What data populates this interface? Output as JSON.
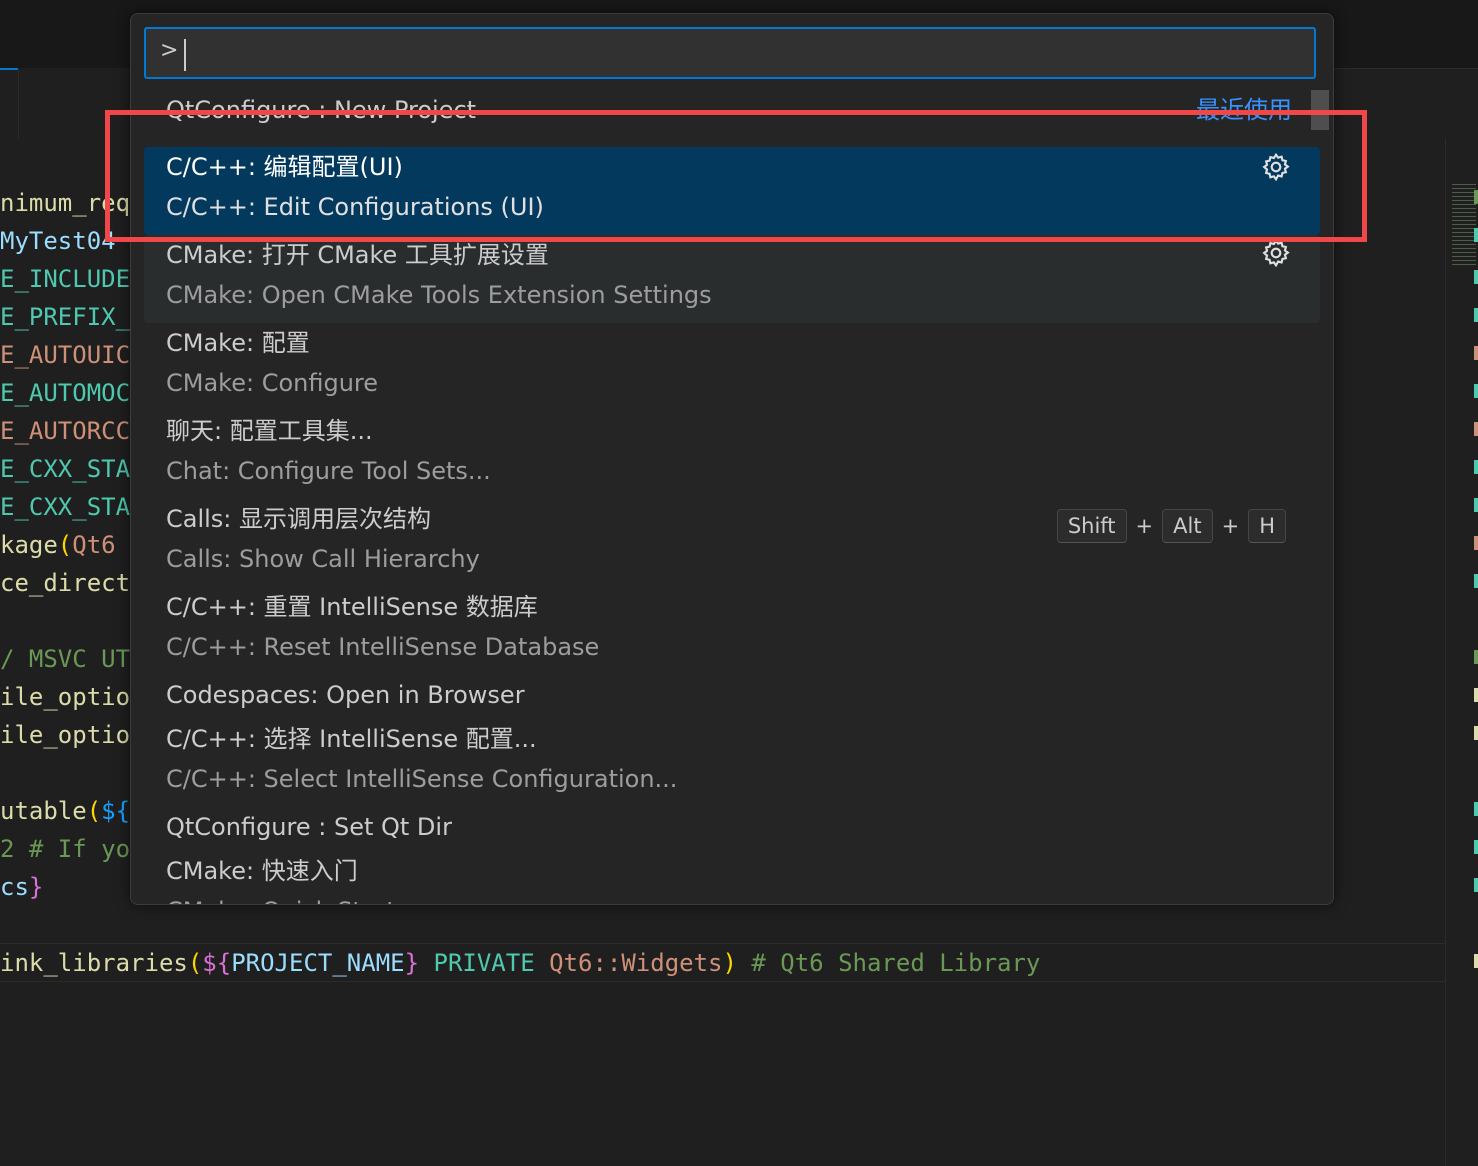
{
  "editor": {
    "lines": [
      {
        "parts": [
          {
            "t": "nimum_req",
            "c": "c-fn"
          }
        ]
      },
      {
        "parts": [
          {
            "t": "MyTest04",
            "c": "c-var"
          }
        ]
      },
      {
        "parts": [
          {
            "t": "E_INCLUDE",
            "c": "c-kw"
          }
        ]
      },
      {
        "parts": [
          {
            "t": "E_PREFIX_",
            "c": "c-kw"
          }
        ]
      },
      {
        "parts": [
          {
            "t": "E_AUTOUIC",
            "c": "c-str"
          }
        ]
      },
      {
        "parts": [
          {
            "t": "E_AUTOMOC",
            "c": "c-kw"
          }
        ]
      },
      {
        "parts": [
          {
            "t": "E_AUTORCC",
            "c": "c-str"
          }
        ]
      },
      {
        "parts": [
          {
            "t": "E_CXX_STA",
            "c": "c-kw"
          }
        ]
      },
      {
        "parts": [
          {
            "t": "E_CXX_STA",
            "c": "c-kw"
          }
        ]
      },
      {
        "parts": [
          {
            "t": "kage",
            "c": "c-fn"
          },
          {
            "t": "(",
            "c": "c-br"
          },
          {
            "t": "Qt6",
            "c": "c-str"
          }
        ]
      },
      {
        "parts": [
          {
            "t": "ce_direct",
            "c": "c-fn"
          }
        ]
      },
      {
        "parts": []
      },
      {
        "parts": [
          {
            "t": "/ MSVC UT",
            "c": "c-cm"
          }
        ]
      },
      {
        "parts": [
          {
            "t": "ile_optio",
            "c": "c-fn"
          }
        ]
      },
      {
        "parts": [
          {
            "t": "ile_optio",
            "c": "c-fn"
          }
        ]
      },
      {
        "parts": []
      },
      {
        "parts": [
          {
            "t": "utable",
            "c": "c-fn"
          },
          {
            "t": "(",
            "c": "c-br"
          },
          {
            "t": "${",
            "c": "c-br3"
          }
        ]
      },
      {
        "parts": [
          {
            "t": "2 # If yo",
            "c": "c-cm"
          }
        ]
      },
      {
        "parts": [
          {
            "t": "cs",
            "c": "c-var"
          },
          {
            "t": "}",
            "c": "c-br2"
          }
        ]
      },
      {
        "parts": []
      },
      {
        "parts": [
          {
            "t": "ink_libraries",
            "c": "c-fn"
          },
          {
            "t": "(",
            "c": "c-br"
          },
          {
            "t": "${",
            "c": "c-br2"
          },
          {
            "t": "PROJECT_NAME",
            "c": "c-var"
          },
          {
            "t": "}",
            "c": "c-br2"
          },
          {
            "t": " PRIVATE ",
            "c": "c-kw"
          },
          {
            "t": "Qt6::Widgets",
            "c": "c-str"
          },
          {
            "t": ")",
            "c": "c-br"
          },
          {
            "t": " # Qt6 Shared Library",
            "c": "c-cm"
          }
        ]
      }
    ]
  },
  "quick_pick": {
    "input_prefix": ">",
    "input_value": "",
    "recent_label": "最近使用",
    "items": [
      {
        "label": "QtConfigure : New Project",
        "detail": "",
        "state": "partial",
        "recent": true
      },
      {
        "label": "C/C++: 编辑配置(UI)",
        "detail": "C/C++: Edit Configurations (UI)",
        "state": "selected",
        "gear": true
      },
      {
        "label": "CMake: 打开 CMake 工具扩展设置",
        "detail": "CMake: Open CMake Tools Extension Settings",
        "state": "hover",
        "gear": true
      },
      {
        "label": "CMake: 配置",
        "detail": "CMake: Configure",
        "state": "normal"
      },
      {
        "label": "聊天: 配置工具集...",
        "detail": "Chat: Configure Tool Sets...",
        "state": "normal"
      },
      {
        "label": "Calls: 显示调用层次结构",
        "detail": "Calls: Show Call Hierarchy",
        "state": "normal",
        "keybinding": [
          "Shift",
          "Alt",
          "H"
        ]
      },
      {
        "label": "C/C++: 重置 IntelliSense 数据库",
        "detail": "C/C++: Reset IntelliSense Database",
        "state": "normal"
      },
      {
        "label": "Codespaces: Open in Browser",
        "detail": "",
        "state": "normal"
      },
      {
        "label": "C/C++: 选择 IntelliSense 配置...",
        "detail": "C/C++: Select IntelliSense Configuration...",
        "state": "normal"
      },
      {
        "label": "QtConfigure : Set Qt Dir",
        "detail": "",
        "state": "normal"
      },
      {
        "label": "CMake: 快速入门",
        "detail": "CMake: Quick Start",
        "state": "normal"
      }
    ],
    "keybinding_separator": "+"
  },
  "colors": {
    "accent": "#0078d4",
    "selection": "#04395e",
    "highlight_box": "#f04848",
    "recent_link": "#3794ff"
  },
  "icons": {
    "gear": "gear-icon"
  }
}
